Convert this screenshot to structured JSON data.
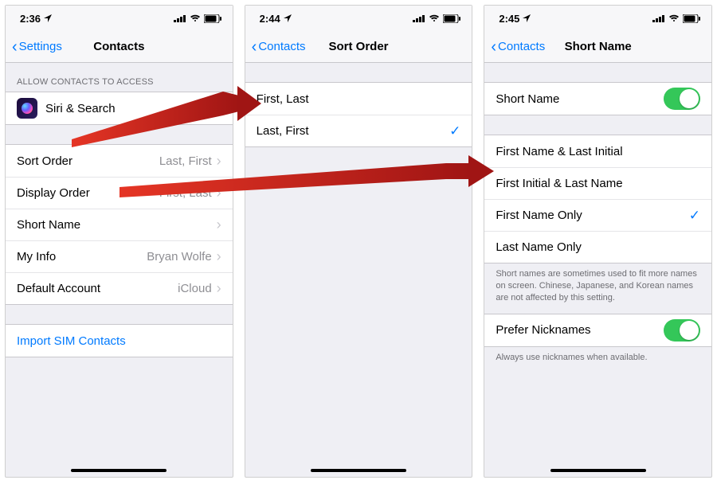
{
  "screens": [
    {
      "status_time": "2:36",
      "nav_back": "Settings",
      "nav_title": "Contacts",
      "section_allow_header": "ALLOW CONTACTS TO ACCESS",
      "siri_label": "Siri & Search",
      "rows": {
        "sort_order": {
          "label": "Sort Order",
          "value": "Last, First"
        },
        "display_order": {
          "label": "Display Order",
          "value": "First, Last"
        },
        "short_name": {
          "label": "Short Name",
          "value": ""
        },
        "my_info": {
          "label": "My Info",
          "value": "Bryan Wolfe"
        },
        "default_account": {
          "label": "Default Account",
          "value": "iCloud"
        }
      },
      "import_sim": "Import SIM Contacts"
    },
    {
      "status_time": "2:44",
      "nav_back": "Contacts",
      "nav_title": "Sort Order",
      "options": [
        {
          "label": "First, Last",
          "selected": false
        },
        {
          "label": "Last, First",
          "selected": true
        }
      ]
    },
    {
      "status_time": "2:45",
      "nav_back": "Contacts",
      "nav_title": "Short Name",
      "short_name_toggle_label": "Short Name",
      "short_name_toggle_on": true,
      "options": [
        {
          "label": "First Name & Last Initial",
          "selected": false
        },
        {
          "label": "First Initial & Last Name",
          "selected": false
        },
        {
          "label": "First Name Only",
          "selected": true
        },
        {
          "label": "Last Name Only",
          "selected": false
        }
      ],
      "options_footer": "Short names are sometimes used to fit more names on screen. Chinese, Japanese, and Korean names are not affected by this setting.",
      "prefer_nicknames_label": "Prefer Nicknames",
      "prefer_nicknames_on": true,
      "prefer_nicknames_footer": "Always use nicknames when available."
    }
  ]
}
